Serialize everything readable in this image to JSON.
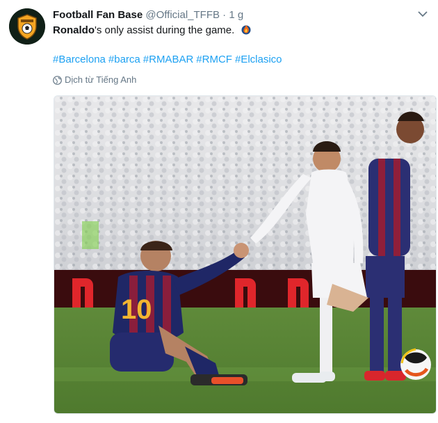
{
  "account": {
    "display_name": "Football Fan Base",
    "handle": "@Official_TFFB",
    "separator": " · ",
    "time": "1 g",
    "avatar_icon": "team-badge-icon"
  },
  "tweet": {
    "bold": "Ronaldo",
    "rest": "'s only assist during the game.",
    "emoji_icon": "fire-emoji-icon"
  },
  "hashtags": [
    "#Barcelona",
    "#barca",
    "#RMABAR",
    "#RMCF",
    "#Elclasico"
  ],
  "translate": {
    "label": "Dịch từ Tiếng Anh",
    "icon": "globe-icon"
  },
  "media": {
    "description_icon": "photo"
  },
  "colors": {
    "link": "#1da1f2",
    "meta": "#657786",
    "text": "#14171a"
  }
}
